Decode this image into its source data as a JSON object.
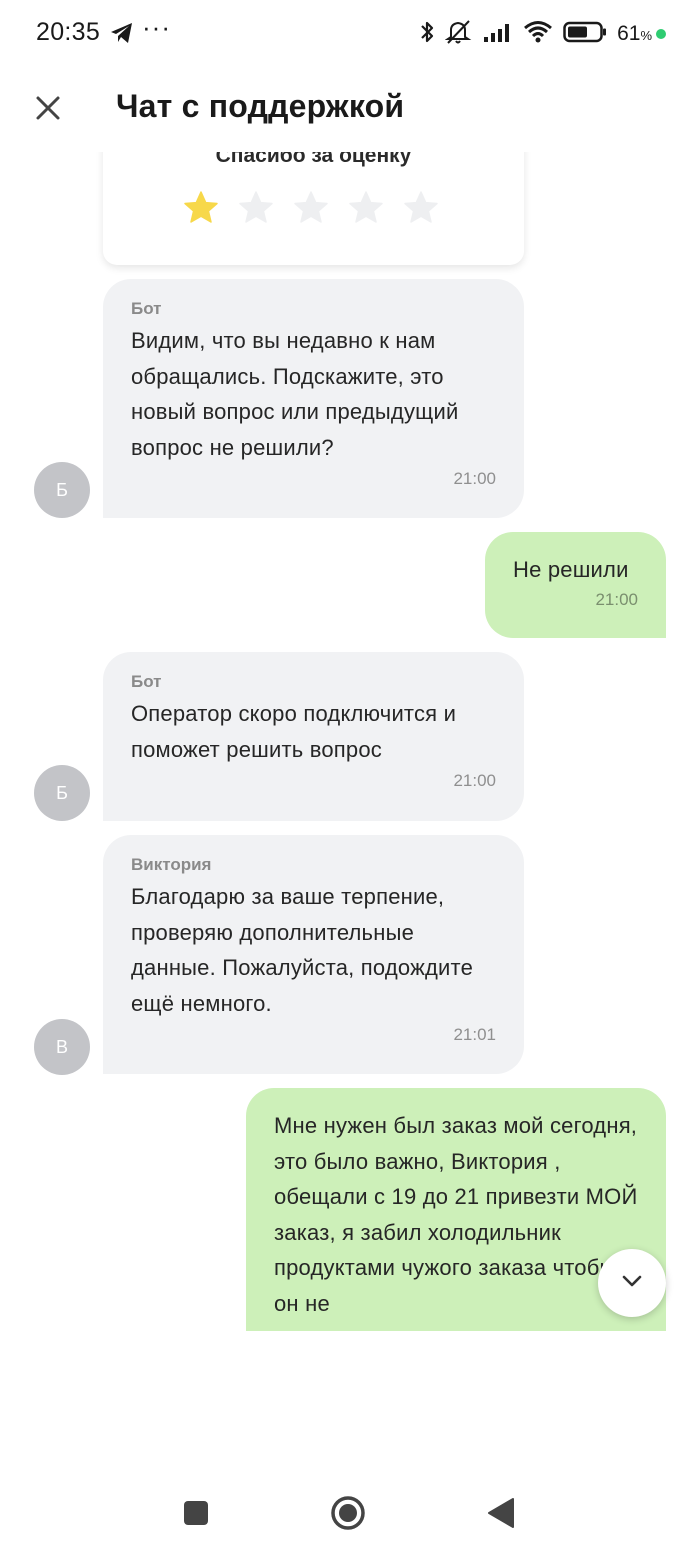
{
  "status_bar": {
    "time": "20:35",
    "dots": "···",
    "battery_percent": "61",
    "percent_sign": "%",
    "icons": [
      "telegram-icon",
      "bluetooth-icon",
      "mute-icon",
      "signal-icon",
      "wifi-icon",
      "battery-icon"
    ]
  },
  "header": {
    "title": "Чат с поддержкой",
    "close_icon": "close-icon"
  },
  "rating": {
    "title": "Спасибо за оценку",
    "value": 1,
    "max": 5,
    "filled_color": "#f7d84a",
    "empty_color": "#eeeff1"
  },
  "messages": [
    {
      "direction": "in",
      "sender": "Бот",
      "avatar": "Б",
      "text": "Видим, что вы недавно к нам обращались. Подскажите, это новый вопрос или предыдущий вопрос не решили?",
      "time": "21:00"
    },
    {
      "direction": "out",
      "text": "Не решили",
      "time": "21:00"
    },
    {
      "direction": "in",
      "sender": "Бот",
      "avatar": "Б",
      "text": "Оператор скоро подключится и поможет решить вопрос",
      "time": "21:00"
    },
    {
      "direction": "in",
      "sender": "Виктория",
      "avatar": "В",
      "text": "Благодарю за ваше терпение, проверяю дополнительные данные. Пожалуйста, подождите ещё немного.",
      "time": "21:01"
    },
    {
      "direction": "out",
      "text": "Мне нужен был заказ мой сегодня, это было важно, Виктория , обещали с 19 до 21 привезти МОЙ заказ, я забил холодильник продуктами чужого заказа чтобы он не",
      "time": ""
    }
  ],
  "scroll_down_icon": "chevron-down-icon",
  "colors": {
    "incoming_bubble": "#f1f2f4",
    "outgoing_bubble": "#cdf0b9",
    "avatar": "#c3c4c8"
  },
  "nav_bar": {
    "icons": [
      "recent-apps-icon",
      "home-icon",
      "back-icon"
    ]
  }
}
